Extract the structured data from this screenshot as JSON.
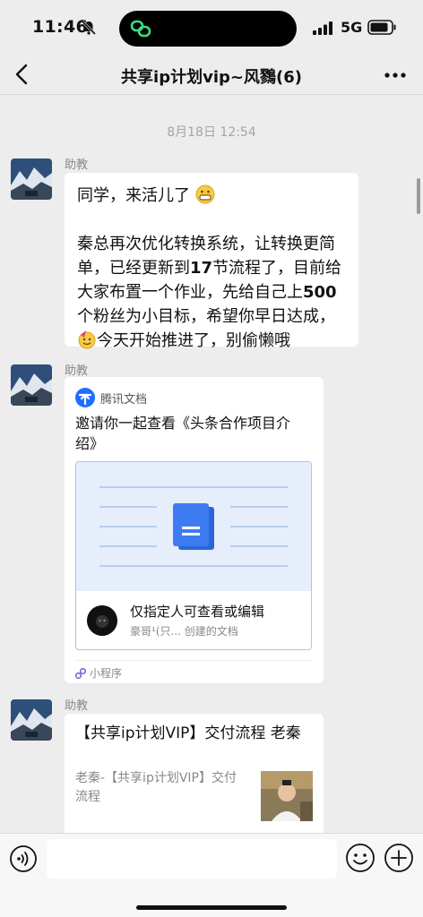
{
  "status": {
    "time": "11:46",
    "network": "5G",
    "bell_icon": "bell-slash-icon",
    "signal_icon": "signal-bars-icon",
    "battery_icon": "battery-icon"
  },
  "nav": {
    "back_icon": "chevron-left-icon",
    "title": "共享ip计划vip~风鷚(6)",
    "more_icon": "ellipsis-icon"
  },
  "chat": {
    "timestamp": "8月18日 12:54",
    "messages": [
      {
        "sender": "助教",
        "line1": "同学，来活儿了",
        "line2a": "秦总再次优化转换系统，让转换更简单，已经更新到",
        "num1": "17",
        "line2b": "节流程了，目前给大家布置一个作业，先给自己上",
        "num2": "500",
        "line2c": "个粉丝为小目标，希望你早日达成，",
        "line2d": "今天开始推进了，别偷懒哦"
      },
      {
        "sender": "助教",
        "source": "腾讯文档",
        "title": "邀请你一起查看《头条合作项目介绍》",
        "permission": "仅指定人可查看或编辑",
        "creator": "豪哥¹(只... 创建的文档",
        "mini_program": "小程序"
      },
      {
        "sender": "助教",
        "title": "【共享ip计划VIP】交付流程 老秦",
        "desc": "老秦-【共享ip计划VIP】交付流程"
      }
    ]
  },
  "input": {
    "placeholder": "",
    "voice_icon": "voice-icon",
    "emoji_icon": "smiley-icon",
    "plus_icon": "plus-circle-icon"
  },
  "colors": {
    "background": "#ededed",
    "bubble": "#ffffff",
    "doc_blue": "#3d7cf0"
  }
}
